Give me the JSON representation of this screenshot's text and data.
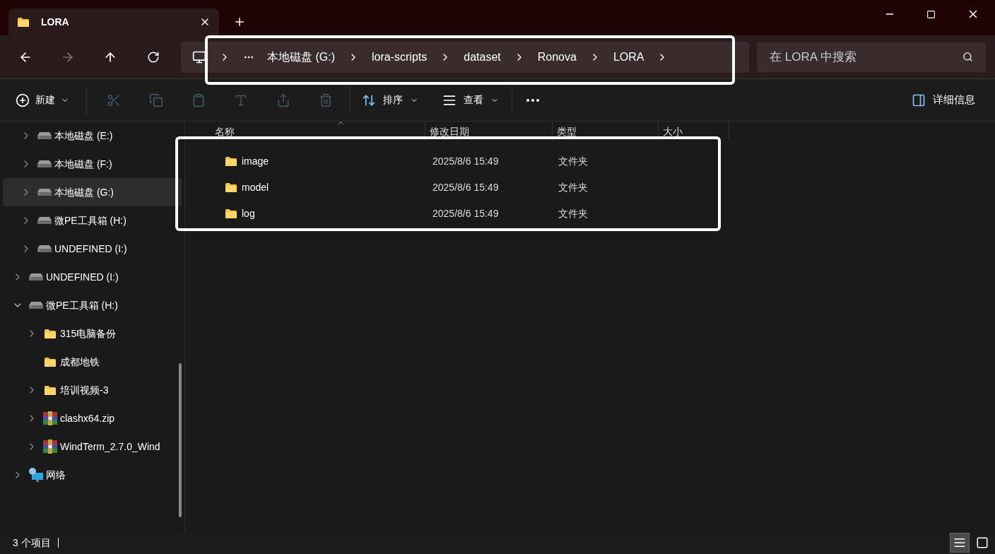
{
  "tab": {
    "title": "LORA"
  },
  "address": {
    "crumbs": [
      "本地磁盘 (G:)",
      "lora-scripts",
      "dataset",
      "Ronova",
      "LORA"
    ]
  },
  "search": {
    "placeholder": "在 LORA 中搜索"
  },
  "toolbar": {
    "items": [
      {
        "kind": "new",
        "label": "新建",
        "disabled": false
      },
      {
        "kind": "cut",
        "disabled": true
      },
      {
        "kind": "copy",
        "disabled": true
      },
      {
        "kind": "paste",
        "disabled": true
      },
      {
        "kind": "rename",
        "disabled": true
      },
      {
        "kind": "share",
        "disabled": true
      },
      {
        "kind": "delete",
        "disabled": true
      },
      {
        "kind": "sort",
        "label": "排序",
        "disabled": false
      },
      {
        "kind": "view",
        "label": "查看",
        "disabled": false
      },
      {
        "kind": "more",
        "disabled": false
      }
    ],
    "details": {
      "label": "详细信息"
    }
  },
  "sidebar": {
    "continued_items": [
      {
        "label": "本地磁盘 (E:)",
        "kind": "drive",
        "expandable": true,
        "expanded": false,
        "selected": false
      },
      {
        "label": "本地磁盘 (F:)",
        "kind": "drive",
        "expandable": true,
        "expanded": false,
        "selected": false
      },
      {
        "label": "本地磁盘 (G:)",
        "kind": "drive",
        "expandable": true,
        "expanded": false,
        "selected": true
      },
      {
        "label": "微PE工具箱 (H:)",
        "kind": "drive",
        "expandable": true,
        "expanded": false,
        "selected": false
      },
      {
        "label": "UNDEFINED (I:)",
        "kind": "drive",
        "expandable": true,
        "expanded": false,
        "selected": false
      }
    ],
    "items": [
      {
        "label": "UNDEFINED (I:)",
        "kind": "drive",
        "expandable": true,
        "expanded": false,
        "selected": false
      },
      {
        "label": "微PE工具箱 (H:)",
        "kind": "drive",
        "expandable": true,
        "expanded": true,
        "selected": false,
        "children": [
          {
            "label": "315电脑备份",
            "kind": "folder",
            "expandable": true,
            "expanded": false,
            "selected": false
          },
          {
            "label": "成都地铁",
            "kind": "folder",
            "expandable": false,
            "expanded": false,
            "selected": false
          },
          {
            "label": "培训视频-3",
            "kind": "folder",
            "expandable": true,
            "expanded": false,
            "selected": false
          },
          {
            "label": "clashx64.zip",
            "kind": "archive",
            "expandable": true,
            "expanded": false,
            "selected": false
          },
          {
            "label": "WindTerm_2.7.0_Wind",
            "kind": "archive",
            "expandable": true,
            "expanded": false,
            "selected": false
          }
        ]
      },
      {
        "label": "网络",
        "kind": "network",
        "expandable": true,
        "expanded": false,
        "selected": false
      }
    ]
  },
  "table": {
    "columns": [
      "名称",
      "修改日期",
      "类型",
      "大小"
    ],
    "rows": [
      {
        "name": "image",
        "modified": "2025/8/6 15:49",
        "type": "文件夹"
      },
      {
        "name": "model",
        "modified": "2025/8/6 15:49",
        "type": "文件夹"
      },
      {
        "name": "log",
        "modified": "2025/8/6 15:49",
        "type": "文件夹"
      }
    ]
  },
  "status_bar": {
    "count": "3 个项目",
    "views": [
      {
        "kind": "details",
        "selected": true
      },
      {
        "kind": "tiles",
        "selected": false
      }
    ]
  }
}
